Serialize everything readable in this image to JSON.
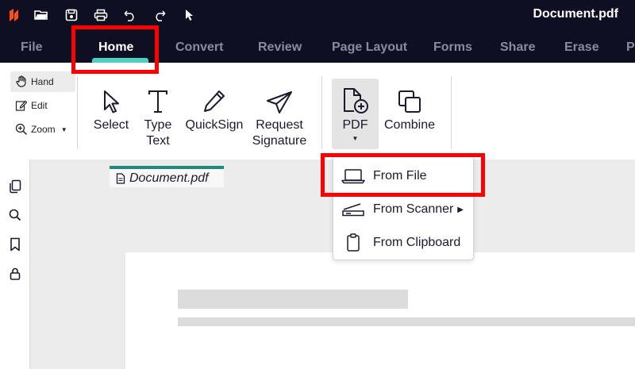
{
  "titlebar": {
    "document_title": "Document.pdf",
    "quick_access": [
      "app-logo-icon",
      "open-folder-icon",
      "save-icon",
      "print-icon",
      "undo-icon",
      "redo-icon",
      "cursor-icon"
    ]
  },
  "tabs": [
    {
      "label": "File",
      "active": false
    },
    {
      "label": "Home",
      "active": true
    },
    {
      "label": "Convert",
      "active": false
    },
    {
      "label": "Review",
      "active": false
    },
    {
      "label": "Page Layout",
      "active": false
    },
    {
      "label": "Forms",
      "active": false
    },
    {
      "label": "Share",
      "active": false
    },
    {
      "label": "Erase",
      "active": false
    },
    {
      "label": "P",
      "active": false
    }
  ],
  "ribbon": {
    "modes": [
      {
        "label": "Hand",
        "active": true
      },
      {
        "label": "Edit",
        "active": false
      },
      {
        "label": "Zoom",
        "active": false
      }
    ],
    "buttons": {
      "select": "Select",
      "type_text_line1": "Type",
      "type_text_line2": "Text",
      "quicksign": "QuickSign",
      "request_signature_line1": "Request",
      "request_signature_line2": "Signature",
      "pdf": "PDF",
      "combine": "Combine"
    }
  },
  "document_tab": {
    "label": "Document.pdf"
  },
  "dropdown": {
    "items": [
      {
        "label": "From File",
        "icon": "laptop-icon"
      },
      {
        "label": "From Scanner",
        "icon": "scanner-icon",
        "has_submenu": true
      },
      {
        "label": "From Clipboard",
        "icon": "clipboard-icon"
      }
    ]
  },
  "colors": {
    "titlebar_bg": "#0f0f23",
    "active_tab_underline": "#4ad1c4",
    "document_tab_accent": "#1e8a7a",
    "highlight_box": "#ff0000",
    "logo": "#ff4d1a"
  }
}
